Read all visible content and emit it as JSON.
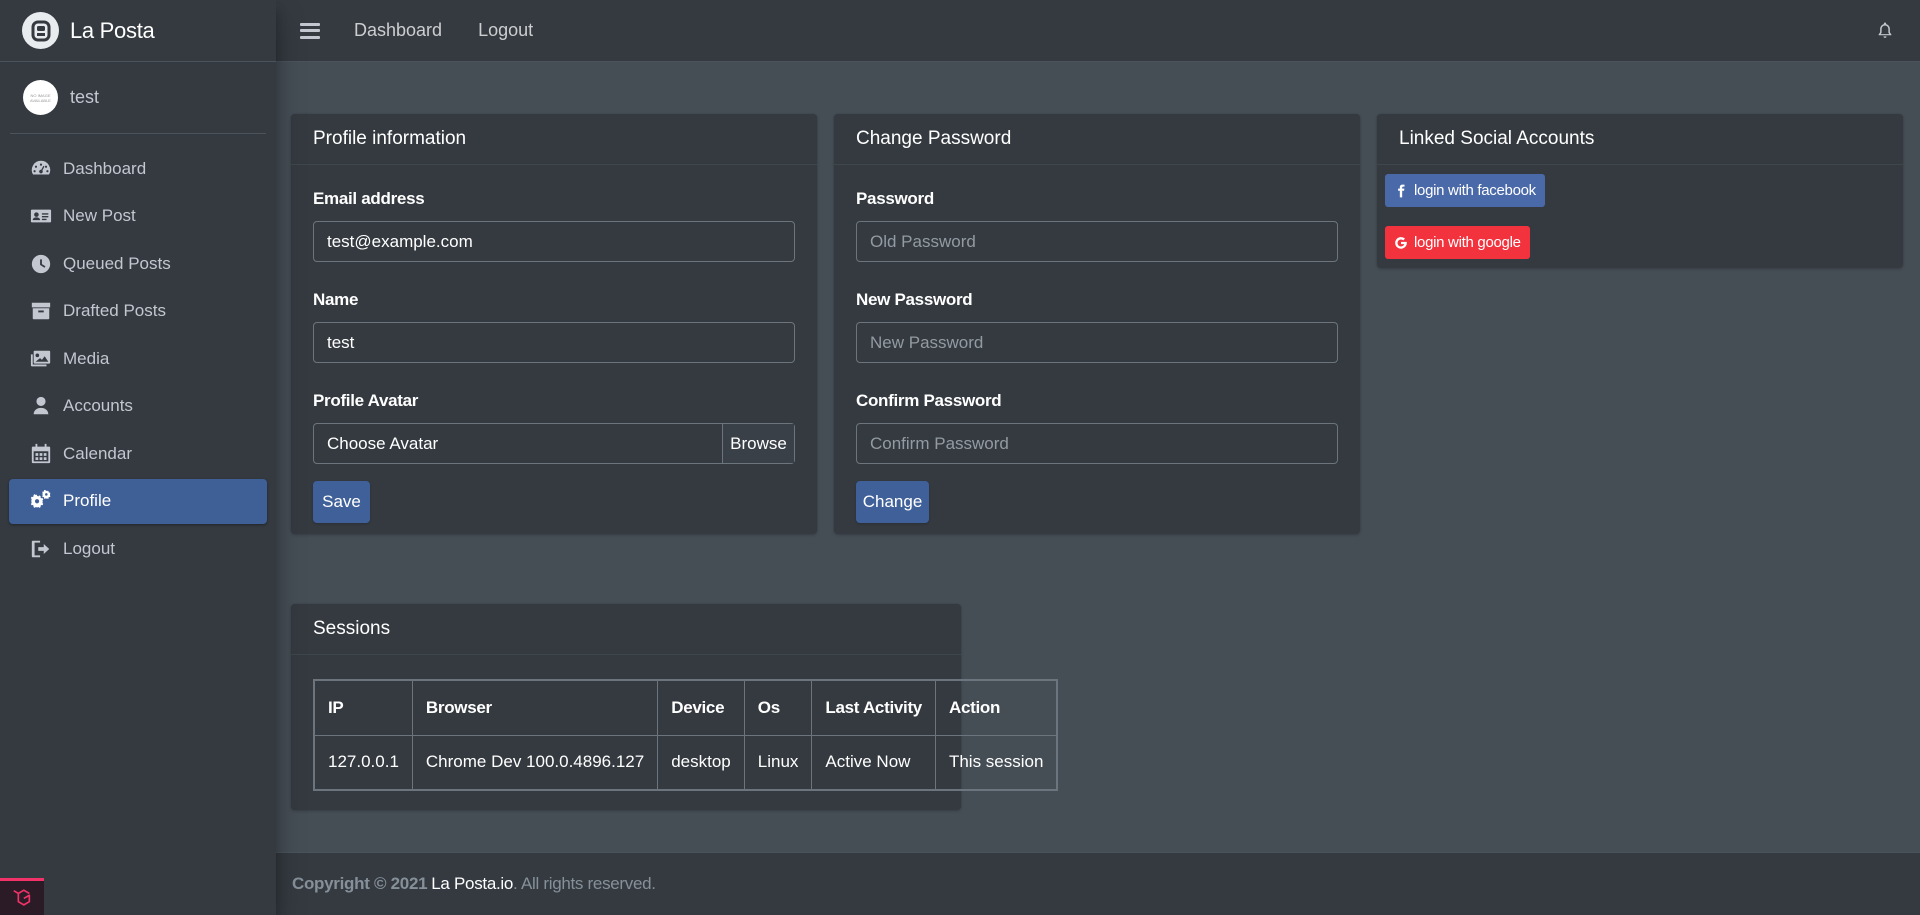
{
  "brand": {
    "name": "La Posta"
  },
  "user": {
    "name": "test",
    "avatar_text": "NO IMAGE AVAILABLE"
  },
  "sidebar": {
    "items": [
      {
        "label": "Dashboard",
        "icon": "tachometer-icon",
        "active": false
      },
      {
        "label": "New Post",
        "icon": "id-card-icon",
        "active": false
      },
      {
        "label": "Queued Posts",
        "icon": "clock-icon",
        "active": false
      },
      {
        "label": "Drafted Posts",
        "icon": "archive-icon",
        "active": false
      },
      {
        "label": "Media",
        "icon": "images-icon",
        "active": false
      },
      {
        "label": "Accounts",
        "icon": "user-icon",
        "active": false
      },
      {
        "label": "Calendar",
        "icon": "calendar-icon",
        "active": false
      },
      {
        "label": "Profile",
        "icon": "cogs-icon",
        "active": true
      },
      {
        "label": "Logout",
        "icon": "sign-out-icon",
        "active": false
      }
    ]
  },
  "topbar": {
    "links": [
      "Dashboard",
      "Logout"
    ]
  },
  "profile_card": {
    "title": "Profile information",
    "email_label": "Email address",
    "email_value": "test@example.com",
    "name_label": "Name",
    "name_value": "test",
    "avatar_label": "Profile Avatar",
    "avatar_placeholder": "Choose Avatar",
    "browse_label": "Browse",
    "save_label": "Save"
  },
  "password_card": {
    "title": "Change Password",
    "password_label": "Password",
    "password_placeholder": "Old Password",
    "new_label": "New Password",
    "new_placeholder": "New Password",
    "confirm_label": "Confirm Password",
    "confirm_placeholder": "Confirm Password",
    "change_label": "Change"
  },
  "social_card": {
    "title": "Linked Social Accounts",
    "facebook_label": "login with facebook",
    "google_label": "login with google"
  },
  "sessions_card": {
    "title": "Sessions",
    "columns": [
      "IP",
      "Browser",
      "Device",
      "Os",
      "Last Activity",
      "Action"
    ],
    "rows": [
      [
        "127.0.0.1",
        "Chrome Dev 100.0.4896.127",
        "desktop",
        "Linux",
        "Active Now",
        "This session"
      ]
    ]
  },
  "footer": {
    "copyright": "Copyright © 2021",
    "brand_link": "La Posta.io",
    "suffix": ". All rights reserved."
  },
  "colors": {
    "accent": "#3f6099",
    "facebook": "#4a69a8",
    "google": "#f2333e",
    "background": "#454d55",
    "panel": "#343a40"
  }
}
